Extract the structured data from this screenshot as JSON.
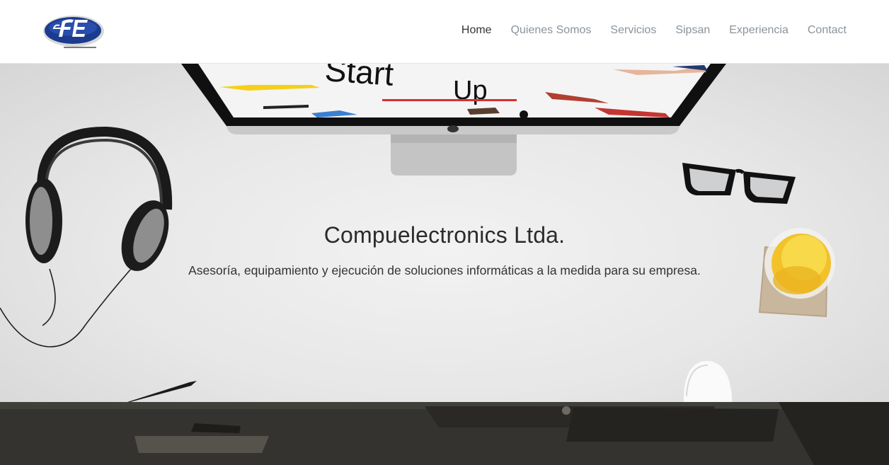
{
  "brand": {
    "logo_icon": "company-logo",
    "logo_colors": [
      "#1a3a8c",
      "#ffffff",
      "#c0c0c0"
    ]
  },
  "nav": {
    "items": [
      {
        "label": "Home",
        "active": true
      },
      {
        "label": "Quienes Somos",
        "active": false
      },
      {
        "label": "Servicios",
        "active": false
      },
      {
        "label": "Sipsan",
        "active": false
      },
      {
        "label": "Experiencia",
        "active": false
      },
      {
        "label": "Contact",
        "active": false
      }
    ]
  },
  "hero": {
    "title": "Compuelectronics Ltda.",
    "subtitle": "Asesoría, equipamiento y ejecución de soluciones informáticas a la medida para su empresa.",
    "background_items": [
      "headphones-icon",
      "monitor-icon",
      "glasses-icon",
      "juice-glass-icon",
      "mouse-icon",
      "pencil-icon"
    ],
    "screen_text": "Start Up"
  },
  "colors": {
    "nav_active": "#333333",
    "nav_inactive": "#8a939b",
    "hero_bg": "#e7e7e7",
    "dark_section_bg": "#2b2a27"
  }
}
